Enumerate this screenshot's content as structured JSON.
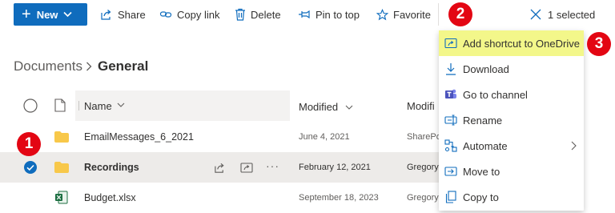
{
  "toolbar": {
    "new_label": "New",
    "share_label": "Share",
    "copy_link_label": "Copy link",
    "delete_label": "Delete",
    "pin_label": "Pin to top",
    "favorite_label": "Favorite",
    "selected_label": "1 selected"
  },
  "breadcrumb": {
    "root": "Documents",
    "separator": ">",
    "current": "General"
  },
  "columns": {
    "name": "Name",
    "modified": "Modified",
    "modified_by": "Modifi"
  },
  "rows": [
    {
      "name": "EmailMessages_6_2021",
      "modified": "June 4, 2021",
      "modified_by": "SharePoi"
    },
    {
      "name": "Recordings",
      "modified": "February 12, 2021",
      "modified_by": "Gregory"
    },
    {
      "name": "Budget.xlsx",
      "modified": "September 18, 2023",
      "modified_by": "Gregory"
    }
  ],
  "menu": {
    "items": [
      {
        "label": "Add shortcut to OneDrive",
        "icon": "shortcut-icon"
      },
      {
        "label": "Download",
        "icon": "download-icon"
      },
      {
        "label": "Go to channel",
        "icon": "teams-icon"
      },
      {
        "label": "Rename",
        "icon": "rename-icon"
      },
      {
        "label": "Automate",
        "icon": "automate-icon"
      },
      {
        "label": "Move to",
        "icon": "move-icon"
      },
      {
        "label": "Copy to",
        "icon": "copy-icon"
      }
    ]
  },
  "callouts": {
    "one": "1",
    "two": "2",
    "three": "3"
  },
  "colors": {
    "accent": "#0f6cbd",
    "callout": "#e30613",
    "highlight": "#f3f78a",
    "folder": "#f8c84a",
    "excel": "#1d6f42"
  }
}
